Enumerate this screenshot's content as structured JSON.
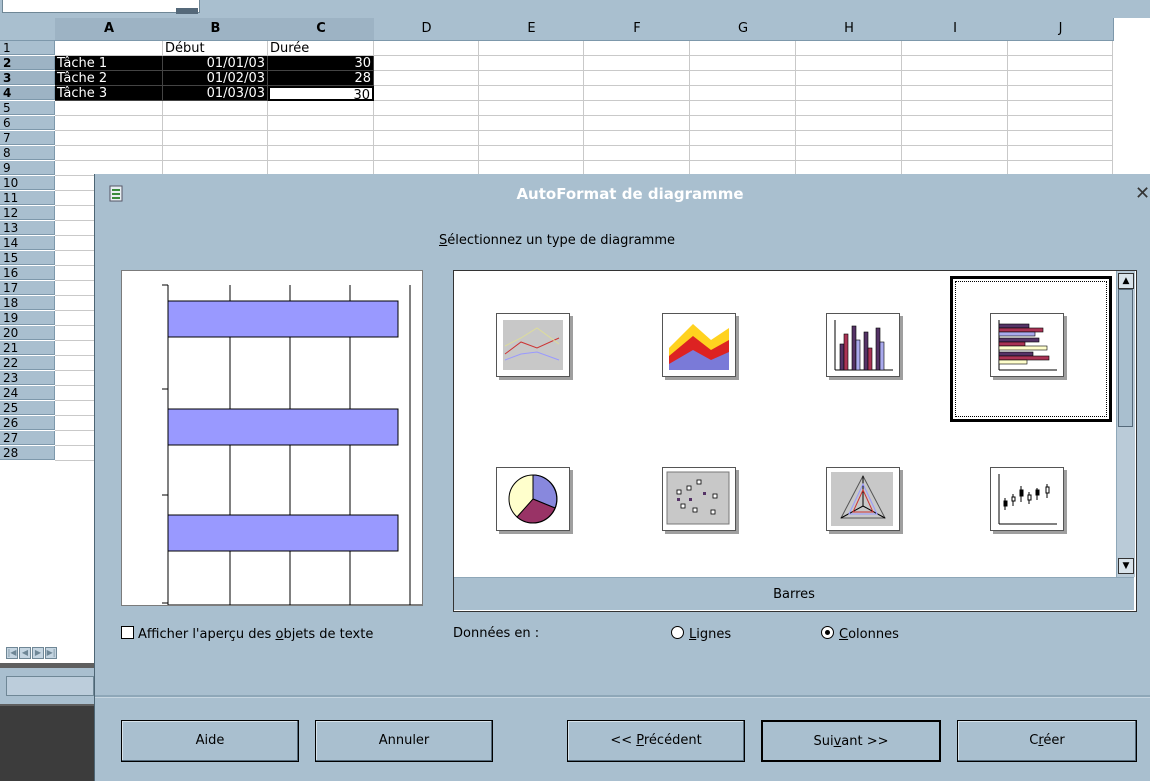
{
  "spreadsheet": {
    "columns": [
      "A",
      "B",
      "C",
      "D",
      "E",
      "F",
      "G",
      "H",
      "I",
      "J"
    ],
    "rows": [
      "1",
      "2",
      "3",
      "4",
      "5",
      "6",
      "7",
      "8",
      "9",
      "10",
      "11",
      "12",
      "13",
      "14",
      "15",
      "16",
      "17",
      "18",
      "19",
      "20",
      "21",
      "22",
      "23",
      "24",
      "25",
      "26",
      "27",
      "28"
    ],
    "cells": {
      "B1": "Début",
      "C1": "Durée",
      "A2": "Tâche 1",
      "B2": "01/01/03",
      "C2": "30",
      "A3": "Tâche 2",
      "B3": "01/02/03",
      "C3": "28",
      "A4": "Tâche 3",
      "B4": "01/03/03",
      "C4": "30"
    }
  },
  "dialog": {
    "title": "AutoFormat de diagramme",
    "subtitle_prefix": "S",
    "subtitle_rest": "électionnez un type de diagramme",
    "selected_type_label": "Barres",
    "chart_types": [
      "line-chart-icon",
      "area-chart-icon",
      "column-chart-icon",
      "bar-chart-icon",
      "pie-chart-icon",
      "xy-scatter-icon",
      "net-chart-icon",
      "stock-chart-icon"
    ],
    "preview_checkbox": {
      "before": "Afficher l'aperçu des ",
      "underline": "o",
      "after": "bjets de texte",
      "checked": false
    },
    "data_in_label": "Données en :",
    "radio_rows": {
      "underline": "L",
      "rest": "ignes",
      "selected": false
    },
    "radio_cols": {
      "underline": "C",
      "rest": "olonnes",
      "selected": true
    },
    "buttons": {
      "help": "Aide",
      "cancel": "Annuler",
      "back_prefix": "<< ",
      "back_underline": "P",
      "back_rest": "récédent",
      "next_prefix": "Sui",
      "next_underline": "v",
      "next_rest": "ant >>",
      "create_prefix": "C",
      "create_underline": "r",
      "create_rest": "éer"
    }
  },
  "colors": {
    "dialog_bg": "#a9bfcf",
    "bar_fill": "#9999ff",
    "title_text": "#ffffff"
  }
}
